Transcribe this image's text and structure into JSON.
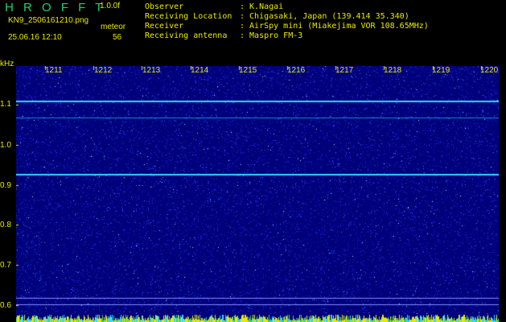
{
  "header": {
    "logo": "H R O F F T",
    "version": "1.0.0f",
    "file_name": "KN9_2506161210.png",
    "meteor_label": "meteor",
    "datetime": "25.06.16 12:10",
    "meteor_count": "56"
  },
  "station_info": [
    {
      "label": "Observer",
      "value": ": K.Nagai"
    },
    {
      "label": "Receiving Location",
      "value": ": Chigasaki, Japan (139.414 35.340)"
    },
    {
      "label": "Receiver",
      "value": ": AirSpy mini (Miakejima VOR 108.65MHz)"
    },
    {
      "label": "Receiving antenna",
      "value": ": Maspro FM-3"
    }
  ],
  "y_axis": {
    "unit": "kHz",
    "ticks": [
      "1.1",
      "1.0",
      "0.9",
      "0.8",
      "0.7",
      "0.6"
    ]
  },
  "x_axis": {
    "ticks": [
      "1211",
      "1212",
      "1213",
      "1214",
      "1215",
      "1216",
      "1217",
      "1218",
      "1219",
      "1220"
    ]
  },
  "spectrogram": {
    "background_color": "#00007a",
    "noise_color": "#2a3cff",
    "line_color": "#38d8ff",
    "label_color": "#e8e800",
    "horizontal_lines_khz": [
      1.11,
      1.067,
      0.927
    ]
  }
}
